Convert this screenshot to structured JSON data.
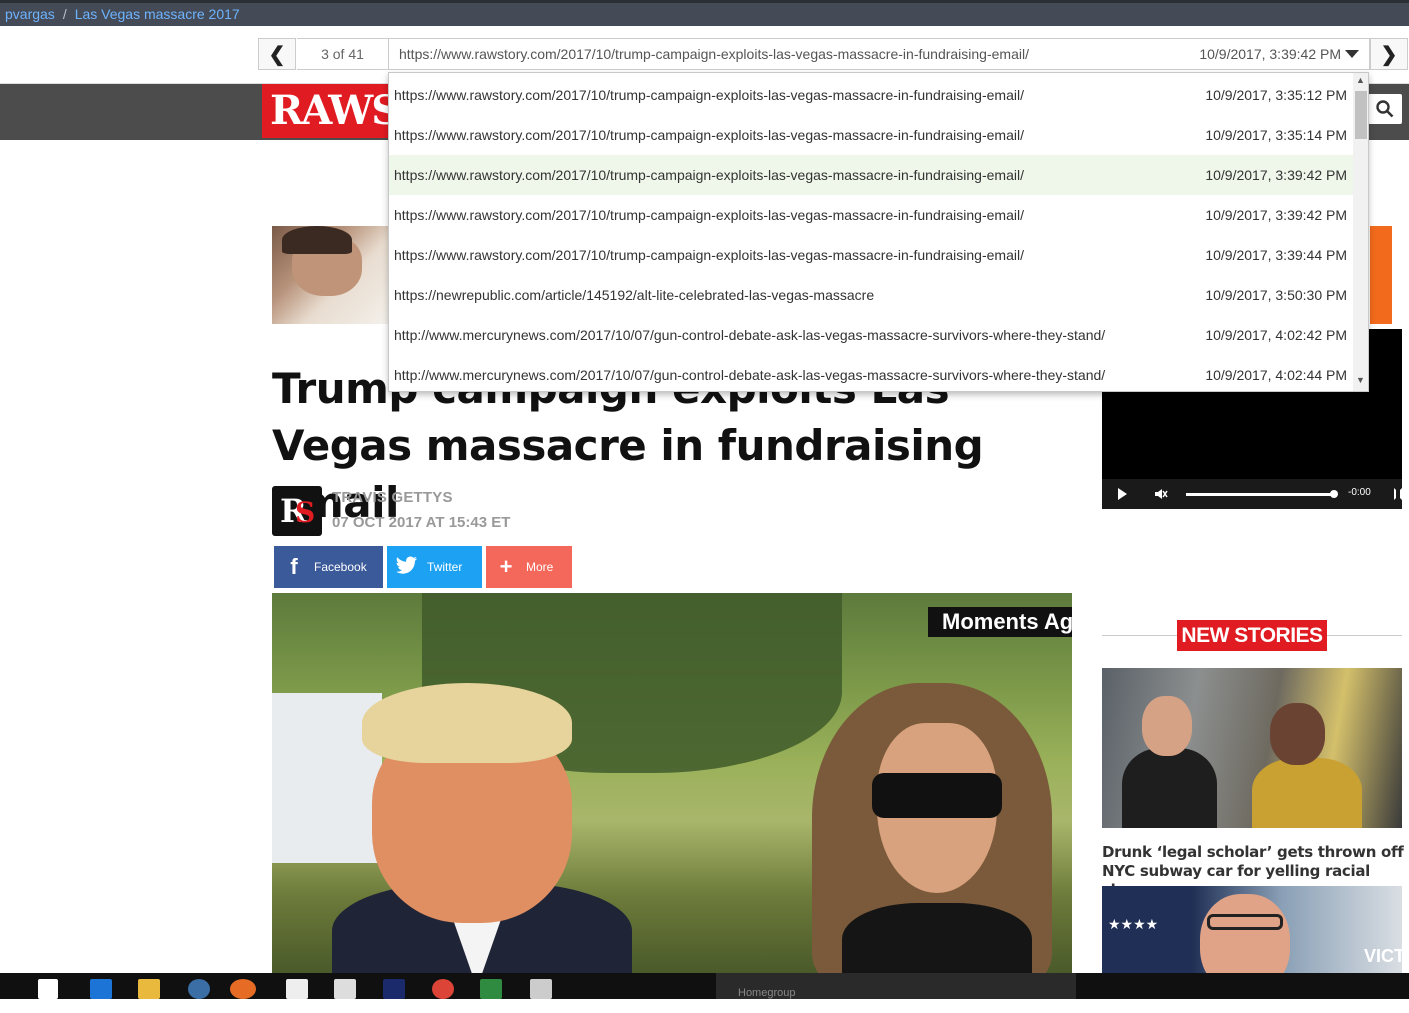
{
  "breadcrumb": {
    "user": "pvargas",
    "separator": "/",
    "collection": "Las Vegas massacre 2017"
  },
  "archive_nav": {
    "prev_icon": "chevron-left-icon",
    "counter": "3 of 41",
    "current_url": "https://www.rawstory.com/2017/10/trump-campaign-exploits-las-vegas-massacre-in-fundraising-email/",
    "current_timestamp": "10/9/2017, 3:39:42 PM",
    "dropdown_icon": "caret-down-icon",
    "next_icon": "chevron-right-icon"
  },
  "dropdown": {
    "items": [
      {
        "url": "https://www.rawstory.com/2017/10/trump-campaign-exploits-las-vegas-massacre-in-fundraising-email/",
        "time": "10/9/2017, 3:35:12 PM"
      },
      {
        "url": "https://www.rawstory.com/2017/10/trump-campaign-exploits-las-vegas-massacre-in-fundraising-email/",
        "time": "10/9/2017, 3:35:14 PM"
      },
      {
        "url": "https://www.rawstory.com/2017/10/trump-campaign-exploits-las-vegas-massacre-in-fundraising-email/",
        "time": "10/9/2017, 3:39:42 PM",
        "selected": true
      },
      {
        "url": "https://www.rawstory.com/2017/10/trump-campaign-exploits-las-vegas-massacre-in-fundraising-email/",
        "time": "10/9/2017, 3:39:42 PM"
      },
      {
        "url": "https://www.rawstory.com/2017/10/trump-campaign-exploits-las-vegas-massacre-in-fundraising-email/",
        "time": "10/9/2017, 3:39:44 PM"
      },
      {
        "url": "https://newrepublic.com/article/145192/alt-lite-celebrated-las-vegas-massacre",
        "time": "10/9/2017, 3:50:30 PM"
      },
      {
        "url": "http://www.mercurynews.com/2017/10/07/gun-control-debate-ask-las-vegas-massacre-survivors-where-they-stand/",
        "time": "10/9/2017, 4:02:42 PM"
      },
      {
        "url": "http://www.mercurynews.com/2017/10/07/gun-control-debate-ask-las-vegas-massacre-survivors-where-they-stand/",
        "time": "10/9/2017, 4:02:44 PM"
      }
    ],
    "selected_color": "#eef7e9"
  },
  "site": {
    "logo_text": "RAWS",
    "brand_color": "#e01b22",
    "search_icon": "search-icon"
  },
  "article": {
    "title": "Trump campaign exploits Las Vegas massacre in fundraising email",
    "author": "TRAVIS GETTYS",
    "date": "07 OCT 2017 AT 15:43 ET",
    "author_logo_r": "R",
    "author_logo_s": "S",
    "share": {
      "facebook": "Facebook",
      "twitter": "Twitter",
      "more": "More",
      "facebook_color": "#3b5a9a",
      "twitter_color": "#1da1f2",
      "more_color": "#f4675b"
    },
    "image_caption": "Moments Ag"
  },
  "video": {
    "time": "-0:00",
    "play_icon": "play-icon",
    "mute_icon": "mute-icon",
    "fullscreen_icon": "fullscreen-icon",
    "progress": 1.0
  },
  "new_stories": {
    "label": "NEW STORIES",
    "story1_title": "Drunk ‘legal scholar’ gets thrown off NYC subway car for yelling racial slurs",
    "story2_sign": "VICT"
  },
  "taskbar": {
    "icons": [
      "windows-start-icon",
      "store-icon",
      "edge-icon",
      "file-explorer-icon",
      "thunderbird-icon",
      "firefox-icon",
      "mail-icon",
      "fx-icon",
      "photoshop-icon",
      "chrome-icon",
      "excel-icon",
      "image-viewer-icon"
    ],
    "homegroup": "Homegroup"
  }
}
